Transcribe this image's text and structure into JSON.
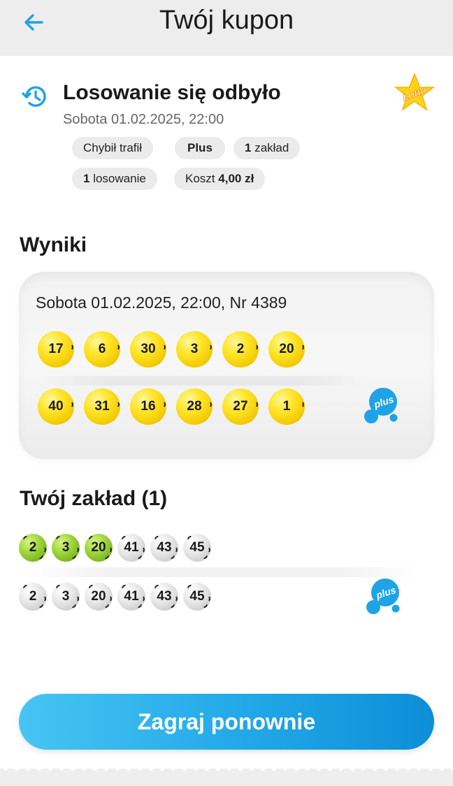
{
  "header": {
    "title": "Twój kupon",
    "back_icon": "arrow-left-icon"
  },
  "draw_info": {
    "status_icon": "history-icon",
    "status": "Losowanie się odbyło",
    "date": "Sobota 01.02.2025, 22:00",
    "game_logo_text": "Lotto",
    "chips": {
      "mode": "Chybił trafił",
      "plus": "Plus",
      "bets_count": "1",
      "bets_label": "zakład",
      "draws_count": "1",
      "draws_label": "losowanie",
      "cost_label": "Koszt",
      "cost_value": "4,00 zł"
    }
  },
  "results": {
    "heading": "Wyniki",
    "draw_line": "Sobota 01.02.2025, 22:00, Nr 4389",
    "lotto_numbers": [
      "17",
      "6",
      "30",
      "3",
      "2",
      "20"
    ],
    "plus_numbers": [
      "40",
      "31",
      "16",
      "28",
      "27",
      "1"
    ],
    "plus_logo_text": "plus"
  },
  "bet": {
    "heading": "Twój zakład (1)",
    "lotto_numbers": [
      "2",
      "3",
      "20",
      "41",
      "43",
      "45"
    ],
    "lotto_hits": [
      true,
      true,
      true,
      false,
      false,
      false
    ],
    "plus_numbers": [
      "2",
      "3",
      "20",
      "41",
      "43",
      "45"
    ],
    "plus_hits": [
      false,
      false,
      false,
      false,
      false,
      false
    ],
    "plus_logo_text": "plus"
  },
  "actions": {
    "play_again": "Zagraj ponownie"
  },
  "colors": {
    "accent_blue": "#1fa3e6",
    "ball_yellow": "#ffe52a",
    "hit_green": "#9fd63c",
    "ball_grey": "#e6e6e6"
  }
}
